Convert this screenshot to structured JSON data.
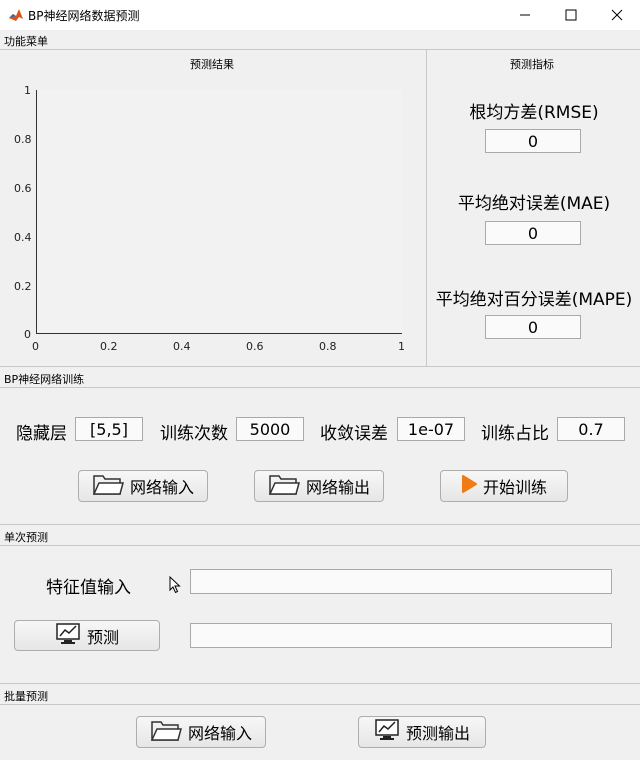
{
  "window": {
    "title": "BP神经网络数据预测"
  },
  "menu": {
    "label": "功能菜单"
  },
  "results_panel": {
    "title": "预测结果",
    "x_ticks": [
      "0",
      "0.2",
      "0.4",
      "0.6",
      "0.8",
      "1"
    ],
    "y_ticks": [
      "0",
      "0.2",
      "0.4",
      "0.6",
      "0.8",
      "1"
    ]
  },
  "chart_data": {
    "type": "line",
    "x": [],
    "series": [],
    "xlim": [
      0,
      1
    ],
    "ylim": [
      0,
      1
    ],
    "title": "",
    "xlabel": "",
    "ylabel": "",
    "x_ticks": [
      "0",
      "0.2",
      "0.4",
      "0.6",
      "0.8",
      "1"
    ],
    "y_ticks": [
      "0",
      "0.2",
      "0.4",
      "0.6",
      "0.8",
      "1"
    ],
    "grid": false
  },
  "metrics_panel": {
    "title": "预测指标",
    "rmse_label": "根均方差(RMSE)",
    "rmse_value": "0",
    "mae_label": "平均绝对误差(MAE)",
    "mae_value": "0",
    "mape_label": "平均绝对百分误差(MAPE)",
    "mape_value": "0"
  },
  "train_panel": {
    "title": "BP神经网络训练",
    "hidden_label": "隐藏层",
    "hidden_value": "[5,5]",
    "epochs_label": "训练次数",
    "epochs_value": "5000",
    "goal_label": "收敛误差",
    "goal_value": "1e-07",
    "ratio_label": "训练占比",
    "ratio_value": "0.7",
    "net_input_btn": "网络输入",
    "net_output_btn": "网络输出",
    "start_btn": "开始训练"
  },
  "single_panel": {
    "title": "单次预测",
    "feature_label": "特征值输入",
    "feature_value": "",
    "predict_btn": "预测",
    "result_value": ""
  },
  "batch_panel": {
    "title": "批量预测",
    "net_input_btn": "网络输入",
    "predict_output_btn": "预测输出"
  },
  "colors": {
    "accent_play": "#f07a14",
    "plot_bg": "#f2f2f2"
  }
}
